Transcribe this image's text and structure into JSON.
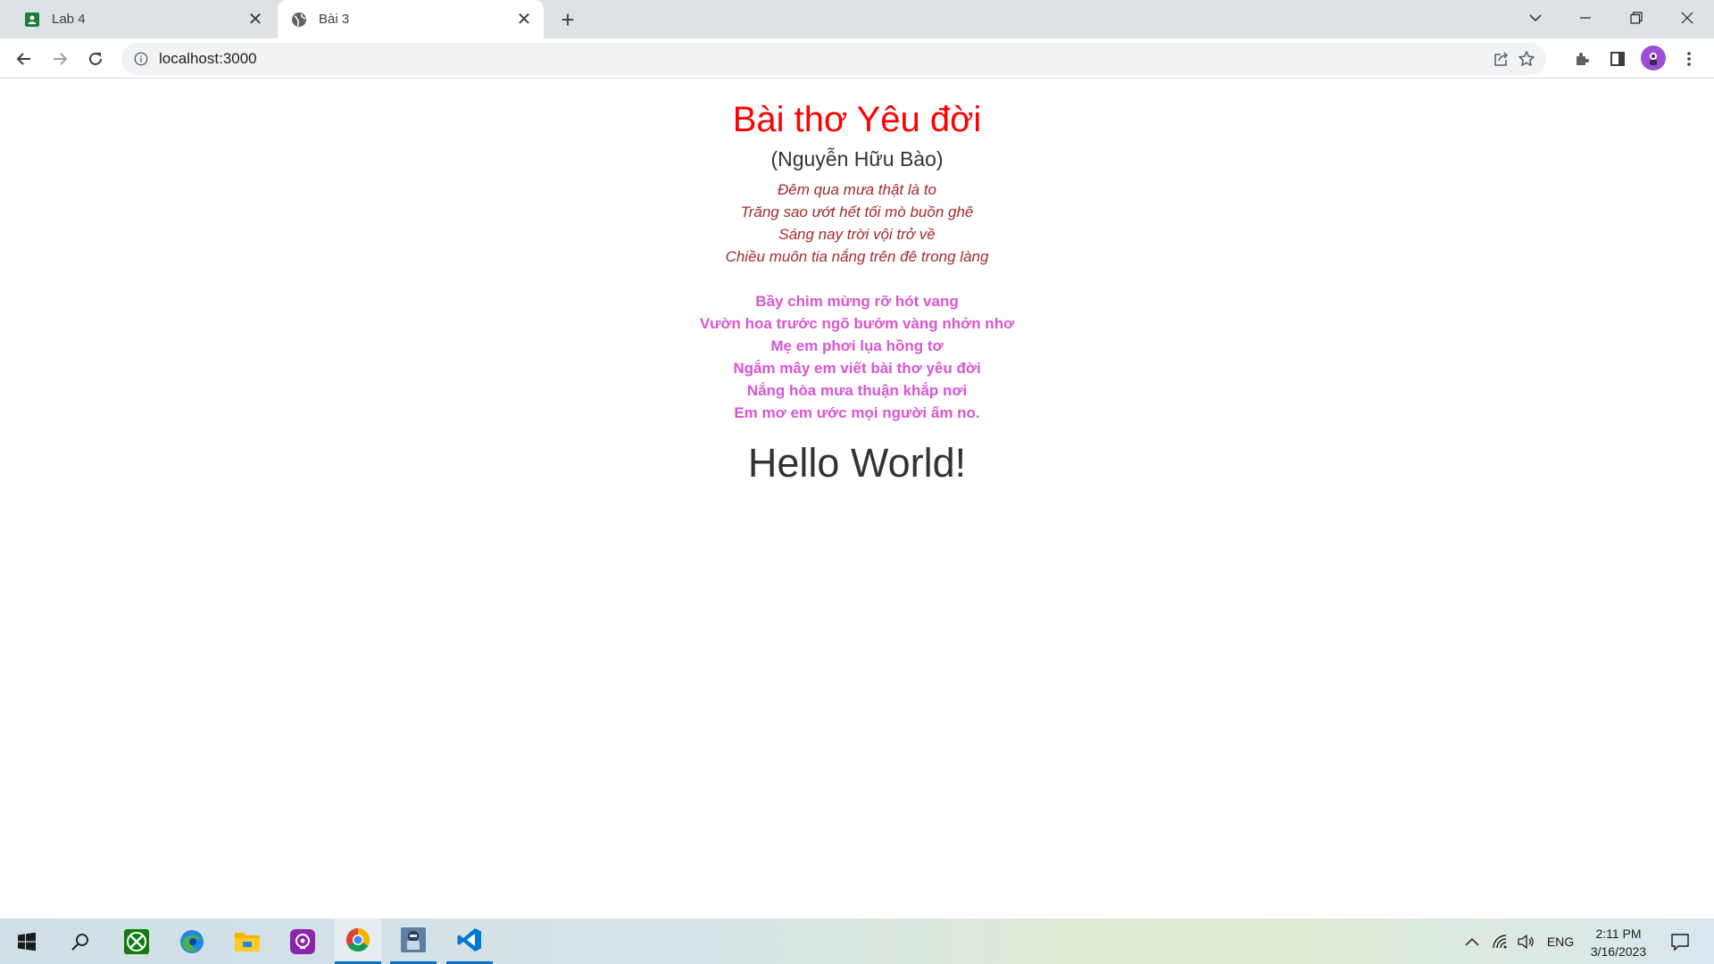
{
  "browser": {
    "tabs": [
      {
        "label": "Lab 4",
        "active": false
      },
      {
        "label": "Bài 3",
        "active": true
      }
    ],
    "url": "localhost:3000"
  },
  "page": {
    "title": "Bài thơ Yêu đời",
    "author": "(Nguyễn Hữu Bào)",
    "stanza1": [
      "Đêm qua mưa thật là to",
      "Trăng sao ướt hết tối mò buồn ghê",
      "Sáng nay trời vội trở về",
      "Chiều muôn tia nắng trên đê trong làng"
    ],
    "stanza2": [
      "Bầy chim mừng rỡ hót vang",
      "Vườn hoa trước ngõ bướm vàng nhởn nhơ",
      "Mẹ em phơi lụa hồng tơ",
      "Ngắm mây em viết bài thơ yêu đời",
      "Nắng hòa mưa thuận khắp nơi",
      "Em mơ em ước mọi người ấm no."
    ],
    "heading": "Hello World!",
    "colors": {
      "title": "#ff0000",
      "stanza1": "#a52a2a",
      "stanza2": "#da55d2"
    }
  },
  "taskbar": {
    "apps": [
      "start-icon",
      "search-icon",
      "xbox-icon",
      "edge-icon",
      "file-explorer-icon",
      "podcast-app-icon",
      "chrome-icon",
      "game-app-icon",
      "vscode-icon"
    ],
    "language": "ENG",
    "time": "2:11 PM",
    "date": "3/16/2023"
  }
}
